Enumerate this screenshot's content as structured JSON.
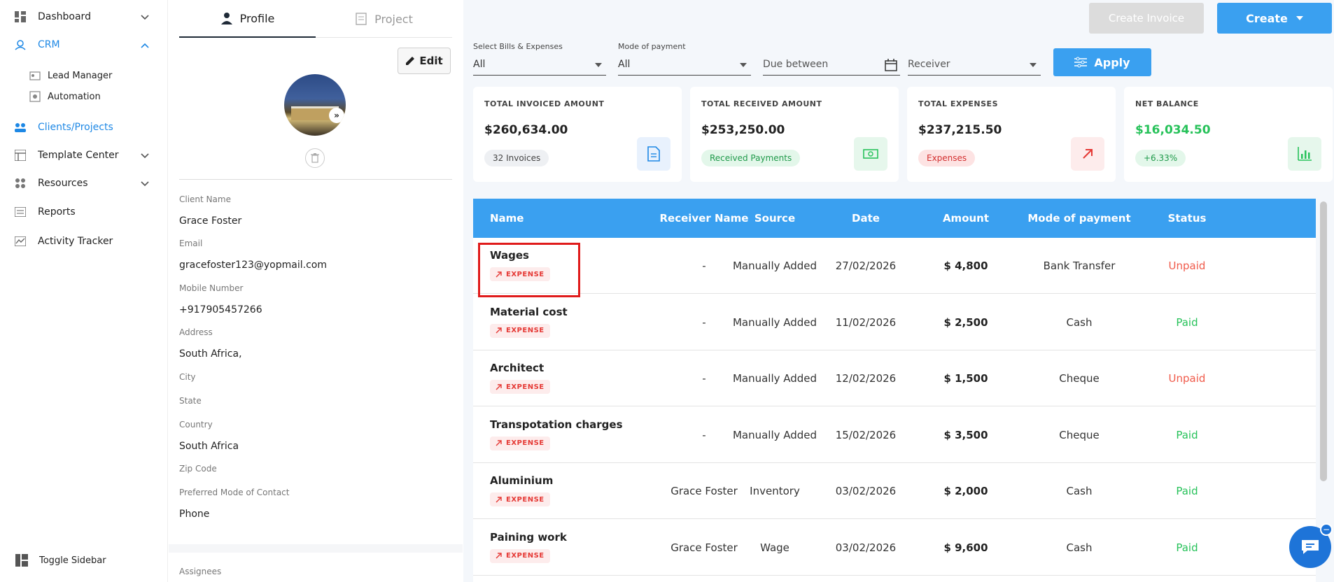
{
  "sidebar": {
    "items": [
      {
        "label": "Dashboard",
        "icon": "dashboard-icon"
      },
      {
        "label": "CRM",
        "icon": "crm-icon"
      },
      {
        "label": "Lead Manager",
        "icon": "lead-manager-icon"
      },
      {
        "label": "Automation",
        "icon": "automation-icon"
      },
      {
        "label": "Clients/Projects",
        "icon": "clients-icon"
      },
      {
        "label": "Template Center",
        "icon": "template-icon"
      },
      {
        "label": "Resources",
        "icon": "resources-icon"
      },
      {
        "label": "Reports",
        "icon": "reports-icon"
      },
      {
        "label": "Activity Tracker",
        "icon": "activity-icon"
      }
    ],
    "toggle_label": "Toggle Sidebar"
  },
  "profile": {
    "tabs": [
      "Profile",
      "Project"
    ],
    "edit_label": "Edit",
    "fields": [
      {
        "label": "Client Name",
        "value": "Grace Foster"
      },
      {
        "label": "Email",
        "value": "gracefoster123@yopmail.com"
      },
      {
        "label": "Mobile Number",
        "value": "+917905457266"
      },
      {
        "label": "Address",
        "value": "South Africa,"
      },
      {
        "label": "City",
        "value": ""
      },
      {
        "label": "State",
        "value": ""
      },
      {
        "label": "Country",
        "value": "South Africa"
      },
      {
        "label": "Zip Code",
        "value": ""
      },
      {
        "label": "Preferred Mode of Contact",
        "value": "Phone"
      }
    ],
    "assignees_label": "Assignees"
  },
  "toolbar": {
    "create_invoice_label": "Create Invoice",
    "create_label": "Create"
  },
  "filters": {
    "bills_label": "Select Bills & Expenses",
    "bills_value": "All",
    "mode_label": "Mode of payment",
    "mode_value": "All",
    "due_placeholder": "Due between",
    "receiver_placeholder": "Receiver",
    "apply_label": "Apply"
  },
  "cards": [
    {
      "title": "TOTAL INVOICED AMOUNT",
      "value": "$260,634.00",
      "badge": "32 Invoices",
      "icon": "document-icon",
      "accent": "#1e88e5"
    },
    {
      "title": "TOTAL RECEIVED AMOUNT",
      "value": "$253,250.00",
      "badge": "Received Payments",
      "icon": "cash-icon",
      "accent": "#27c25a"
    },
    {
      "title": "TOTAL EXPENSES",
      "value": "$237,215.50",
      "badge": "Expenses",
      "icon": "arrow-up-right-icon",
      "accent": "#e53935"
    },
    {
      "title": "NET BALANCE",
      "value": "$16,034.50",
      "badge": "+6.33%",
      "icon": "bar-chart-icon",
      "accent": "#27c25a"
    }
  ],
  "table": {
    "headers": [
      "Name",
      "Receiver Name",
      "Source",
      "Date",
      "Amount",
      "Mode of payment",
      "Status"
    ],
    "badge_label": "EXPENSE",
    "rows": [
      {
        "name": "Wages",
        "receiver": "-",
        "source": "Manually Added",
        "date": "27/02/2026",
        "amount": "$ 4,800",
        "mode": "Bank Transfer",
        "status": "Unpaid"
      },
      {
        "name": "Material cost",
        "receiver": "-",
        "source": "Manually Added",
        "date": "11/02/2026",
        "amount": "$ 2,500",
        "mode": "Cash",
        "status": "Paid"
      },
      {
        "name": "Architect",
        "receiver": "-",
        "source": "Manually Added",
        "date": "12/02/2026",
        "amount": "$ 1,500",
        "mode": "Cheque",
        "status": "Unpaid"
      },
      {
        "name": "Transpotation charges",
        "receiver": "-",
        "source": "Manually Added",
        "date": "15/02/2026",
        "amount": "$ 3,500",
        "mode": "Cheque",
        "status": "Paid"
      },
      {
        "name": "Aluminium",
        "receiver": "Grace Foster",
        "source": "Inventory",
        "date": "03/02/2026",
        "amount": "$ 2,000",
        "mode": "Cash",
        "status": "Paid"
      },
      {
        "name": "Paining work",
        "receiver": "Grace Foster",
        "source": "Wage",
        "date": "03/02/2026",
        "amount": "$ 9,600",
        "mode": "Cash",
        "status": "Paid"
      }
    ]
  }
}
